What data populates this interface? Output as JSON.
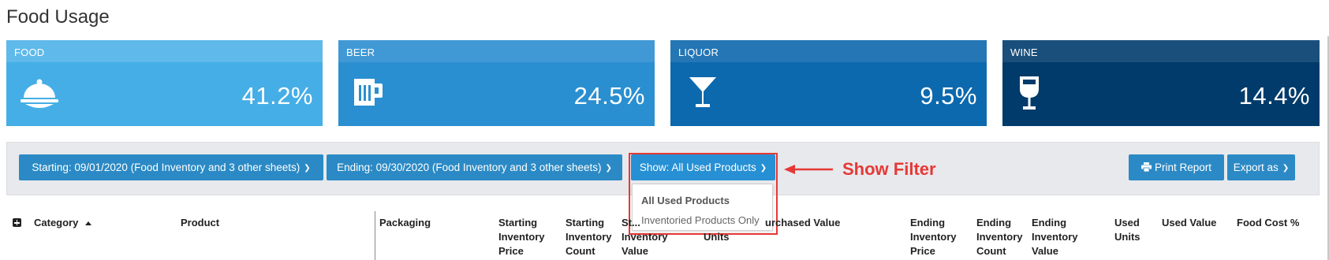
{
  "page": {
    "title": "Food Usage"
  },
  "cards": [
    {
      "label": "FOOD",
      "value": "41.2%",
      "icon": "cloche-icon",
      "color": "#45aee6",
      "head_color": "#5fb9ea"
    },
    {
      "label": "BEER",
      "value": "24.5%",
      "icon": "beer-mug-icon",
      "color": "#2a8fd0",
      "head_color": "#4099d5"
    },
    {
      "label": "LIQUOR",
      "value": "9.5%",
      "icon": "martini-glass-icon",
      "color": "#0d69ae",
      "head_color": "#2476b5"
    },
    {
      "label": "WINE",
      "value": "14.4%",
      "icon": "wine-glass-icon",
      "color": "#003b6b",
      "head_color": "#1a4f7c"
    }
  ],
  "filters": {
    "starting_label": "Starting: 09/01/2020 (Food Inventory and 3 other sheets)",
    "ending_label": "Ending: 09/30/2020 (Food Inventory and 3 other sheets)",
    "show_label": "Show: All Used Products",
    "show_options": [
      "All Used Products",
      "Inventoried Products Only"
    ],
    "print_label": "Print Report",
    "export_label": "Export as"
  },
  "annotation": {
    "text": "Show Filter",
    "color": "#e53935"
  },
  "table": {
    "headers": {
      "category": "Category",
      "product": "Product",
      "packaging": "Packaging",
      "starting_inventory_price": "Starting Inventory Price",
      "starting_inventory_count": "Starting Inventory Count",
      "starting_inventory_value_partial": "St... Inventory Value",
      "purchased_units_partial": "Units",
      "purchased_value_partial": "urchased Value",
      "ending_inventory_price": "Ending Inventory Price",
      "ending_inventory_count": "Ending Inventory Count",
      "ending_inventory_value": "Ending Inventory Value",
      "used_units": "Used Units",
      "used_value": "Used Value",
      "food_cost_pct": "Food Cost %"
    }
  }
}
